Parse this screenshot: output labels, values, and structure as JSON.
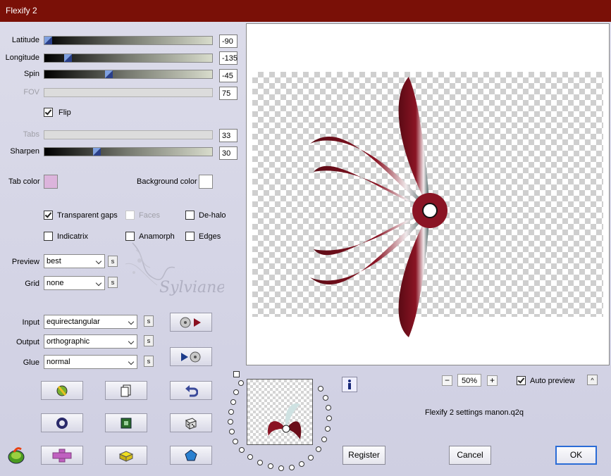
{
  "window": {
    "title": "Flexify 2"
  },
  "sliders": [
    {
      "label": "Latitude",
      "value": "-90",
      "fraction": 0.0,
      "enabled": true
    },
    {
      "label": "Longitude",
      "value": "-135",
      "fraction": 0.125,
      "enabled": true
    },
    {
      "label": "Spin",
      "value": "-45",
      "fraction": 0.375,
      "enabled": true
    },
    {
      "label": "FOV",
      "value": "75",
      "enabled": false
    },
    {
      "label": "Tabs",
      "value": "33",
      "enabled": false
    },
    {
      "label": "Sharpen",
      "value": "30",
      "fraction": 0.3,
      "enabled": true
    }
  ],
  "flip": {
    "label": "Flip",
    "checked": true
  },
  "colors": {
    "tab_color_label": "Tab color",
    "tab_color": "#dcb4dc",
    "background_color_label": "Background color",
    "background_color": "#ffffff"
  },
  "options": {
    "transparent_gaps": {
      "label": "Transparent gaps",
      "checked": true
    },
    "faces": {
      "label": "Faces",
      "checked": false
    },
    "de_halo": {
      "label": "De-halo",
      "checked": false
    },
    "indicatrix": {
      "label": "Indicatrix",
      "checked": false
    },
    "anamorph": {
      "label": "Anamorph",
      "checked": false
    },
    "edges": {
      "label": "Edges",
      "checked": false
    }
  },
  "preview_select": {
    "label": "Preview",
    "value": "best"
  },
  "grid_select": {
    "label": "Grid",
    "value": "none"
  },
  "input_select": {
    "label": "Input",
    "value": "equirectangular"
  },
  "output_select": {
    "label": "Output",
    "value": "orthographic"
  },
  "glue_select": {
    "label": "Glue",
    "value": "normal"
  },
  "s_label": "s",
  "watermark": "Sylviane",
  "zoom": {
    "value": "50%",
    "minus": "−",
    "plus": "+"
  },
  "auto_preview": {
    "label": "Auto preview",
    "checked": true
  },
  "collapse_label": "^",
  "settings_file": "Flexify 2 settings manon.q2q",
  "buttons": {
    "register": "Register",
    "cancel": "Cancel",
    "ok": "OK"
  },
  "accent": {
    "title_bar": "#7a1007",
    "ok_border": "#2b6cd6"
  }
}
